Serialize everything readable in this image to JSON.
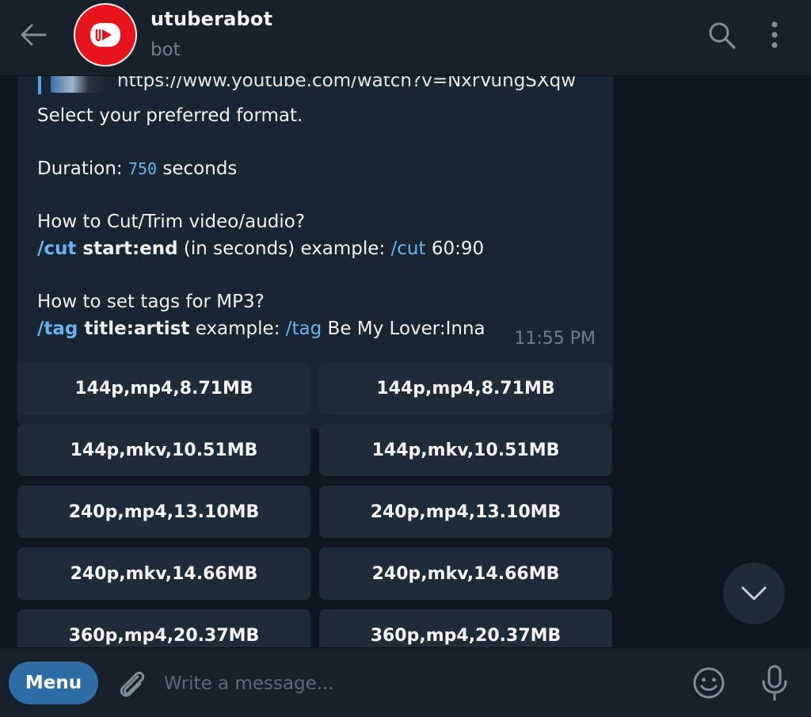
{
  "header": {
    "title": "utuberabot",
    "status": "bot"
  },
  "message": {
    "reply_url": "https://www.youtube.com/watch?v=NxrVungSXqw",
    "intro": "Select your preferred format.",
    "duration_label": "Duration: ",
    "duration_value": "750",
    "duration_unit": " seconds",
    "cut_question": "How to Cut/Trim video/audio?",
    "cut_cmd": "/cut",
    "cut_args": " start:end",
    "cut_desc": " (in seconds) example: ",
    "cut_example_cmd": "/cut",
    "cut_example_val": " 60:90",
    "tag_question": "How to set tags for MP3?",
    "tag_cmd": "/tag",
    "tag_args": " title:artist",
    "tag_desc": " example: ",
    "tag_example_cmd": "/tag",
    "tag_example_val": " Be My Lover:Inna",
    "time": "11:55 PM"
  },
  "keyboard": {
    "rows": [
      [
        "144p,mp4,8.71MB",
        "144p,mp4,8.71MB"
      ],
      [
        "144p,mkv,10.51MB",
        "144p,mkv,10.51MB"
      ],
      [
        "240p,mp4,13.10MB",
        "240p,mp4,13.10MB"
      ],
      [
        "240p,mkv,14.66MB",
        "240p,mkv,14.66MB"
      ],
      [
        "360p,mp4,20.37MB",
        "360p,mp4,20.37MB"
      ]
    ]
  },
  "input": {
    "menu_label": "Menu",
    "placeholder": "Write a message..."
  },
  "colors": {
    "background": "#0e1621",
    "panel": "#17212b",
    "bubble": "#182533",
    "accent": "#6ab2f2",
    "menu_button": "#2f6ea5",
    "avatar": "#e8141c"
  },
  "icons": {
    "back": "arrow-left-icon",
    "search": "search-icon",
    "more": "more-vertical-icon",
    "scroll": "chevron-down-icon",
    "attach": "paperclip-icon",
    "emoji": "emoji-icon",
    "mic": "microphone-icon"
  }
}
